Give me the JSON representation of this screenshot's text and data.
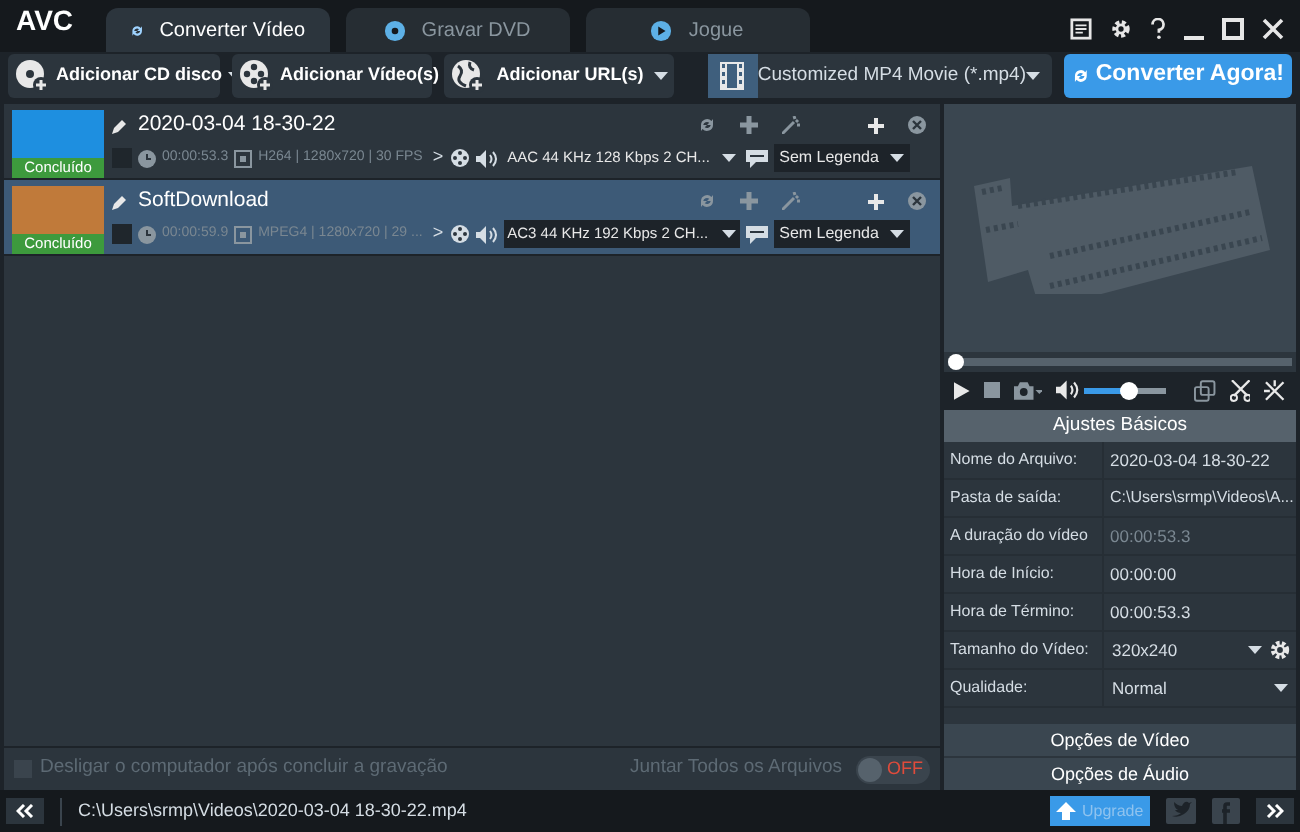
{
  "app_title": "AVC",
  "tabs": [
    {
      "label": "Converter Vídeo",
      "selected": true
    },
    {
      "label": "Gravar DVD",
      "selected": false
    },
    {
      "label": "Jogue",
      "selected": false
    }
  ],
  "toolbar": {
    "buttons": [
      {
        "label": "Adicionar CD disco",
        "kind": "disc",
        "dropdown": true
      },
      {
        "label": "Adicionar Vídeo(s)",
        "kind": "film",
        "dropdown": false
      },
      {
        "label": "Adicionar URL(s)",
        "kind": "globe",
        "dropdown": true
      }
    ],
    "format": "Customized MP4 Movie (*.mp4)",
    "convert": "Converter Agora!"
  },
  "files": [
    {
      "name": "2020-03-04 18-30-22",
      "status": "Concluído",
      "duration": "00:00:53.3",
      "video_info": "H264 | 1280x720 | 30 FPS",
      "separator": ">",
      "audio": "AAC 44 KHz 128 Kbps 2 CH...",
      "subtitle": "Sem Legenda",
      "selected": false
    },
    {
      "name": "SoftDownload",
      "status": "Concluído",
      "duration": "00:00:59.9",
      "video_info": "MPEG4 | 1280x720 | 29 ...",
      "separator": ">",
      "audio": "AC3 44 KHz 192 Kbps 2 CH...",
      "subtitle": "Sem Legenda",
      "selected": true
    }
  ],
  "footer": {
    "shutdown": {
      "label": "Desligar o computador após concluir a gravação",
      "checked": false
    },
    "merge": {
      "label": "Juntar Todos os Arquivos",
      "on": false,
      "state_text": "OFF"
    }
  },
  "player": {
    "seek": {
      "level": 0.0
    },
    "volume": {
      "level": 0.55
    }
  },
  "settings": {
    "title": "Ajustes Básicos",
    "rows": [
      {
        "label": "Nome do Arquivo:",
        "value": "2020-03-04 18-30-22",
        "kind": "text"
      },
      {
        "label": "Pasta de saída:",
        "value": "C:\\Users\\srmp\\Videos\\A...",
        "kind": "folder"
      },
      {
        "label": "A duração do vídeo",
        "value": "00:00:53.3",
        "kind": "dim"
      },
      {
        "label": "Hora de Início:",
        "value": "00:00:00",
        "kind": "text"
      },
      {
        "label": "Hora de Término:",
        "value": "00:00:53.3",
        "kind": "text"
      },
      {
        "label": "Tamanho do Vídeo:",
        "value": "320x240",
        "kind": "dropdown_gear"
      },
      {
        "label": "Qualidade:",
        "value": "Normal",
        "kind": "dropdown"
      }
    ]
  },
  "option_buttons": [
    "Opções de Vídeo",
    "Opções de Áudio"
  ],
  "status_bar": {
    "path": "C:\\Users\\srmp\\Videos\\2020-03-04 18-30-22.mp4",
    "upgrade": "Upgrade"
  }
}
